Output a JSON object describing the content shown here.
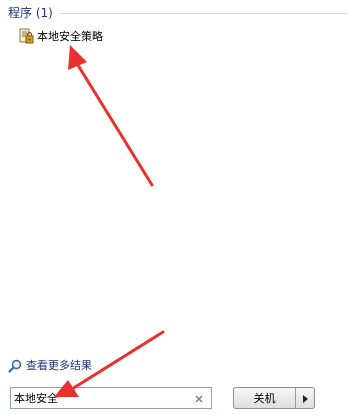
{
  "search_results": {
    "section_title": "程序 (1)",
    "items": [
      {
        "label": "本地安全策略",
        "icon": "security-policy-icon"
      }
    ]
  },
  "see_more": {
    "label": "查看更多结果",
    "icon": "search-icon"
  },
  "search_box": {
    "value": "本地安全",
    "clear_icon": "close-icon"
  },
  "power": {
    "shutdown_label": "关机",
    "arrow_icon": "triangle-right-icon"
  },
  "colors": {
    "header_text": "#1e3287",
    "link_text": "#1e3287",
    "annotation_arrow": "#e8322f"
  }
}
